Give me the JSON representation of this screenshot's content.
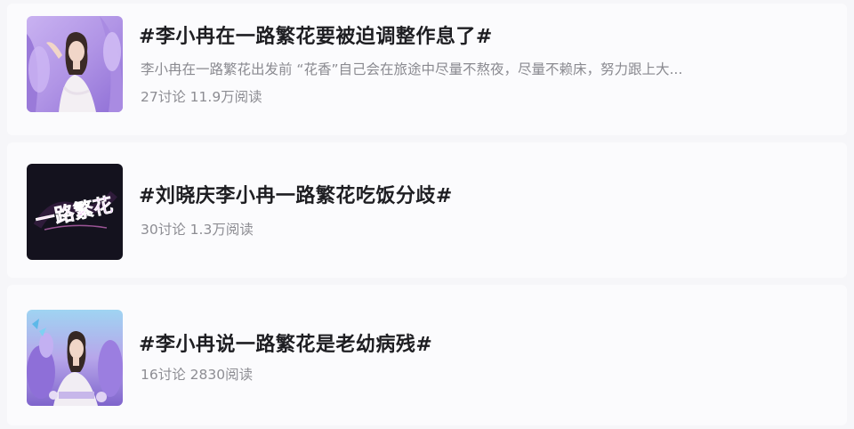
{
  "topics": [
    {
      "title": "#李小冉在一路繁花要被迫调整作息了#",
      "description": "李小冉在一路繁花出发前 “花香”自己会在旅途中尽量不熬夜，尽量不赖床，努力跟上大...",
      "discussions": "27讨论",
      "reads": "11.9万阅读"
    },
    {
      "title": "#刘晓庆李小冉一路繁花吃饭分歧#",
      "thumbnail_text": "一路繁花",
      "discussions": "30讨论",
      "reads": "1.3万阅读"
    },
    {
      "title": "#李小冉说一路繁花是老幼病残#",
      "discussions": "16讨论",
      "reads": "2830阅读"
    }
  ],
  "colors": {
    "title": "#1e1e22",
    "meta": "#8d8d93",
    "thumb_dark": "#14121e",
    "thumb_logo": "#e468c8",
    "thumb_purple": "#b596e6"
  }
}
